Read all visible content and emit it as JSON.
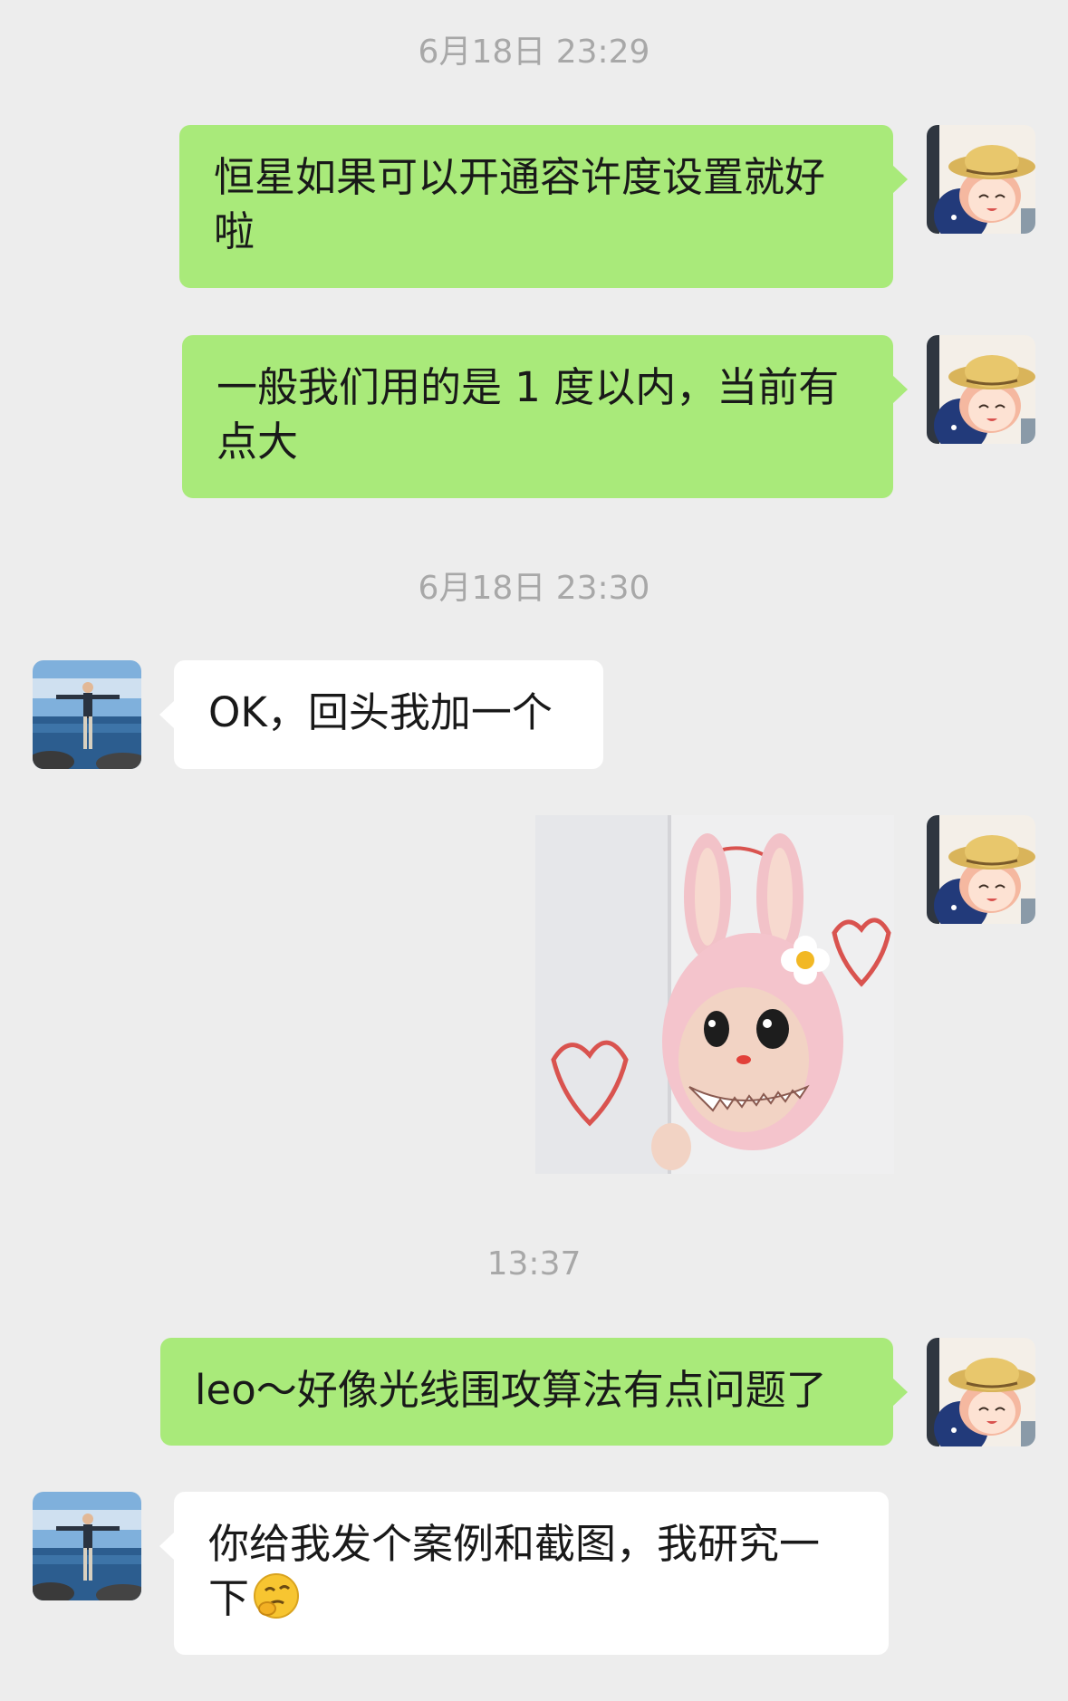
{
  "conversation": {
    "timestamps": [
      "6月18日 23:29",
      "6月18日 23:30",
      "13:37"
    ],
    "messages": [
      {
        "sender": "me",
        "text": "恒星如果可以开通容许度设置就好啦"
      },
      {
        "sender": "me",
        "text": "一般我们用的是 1 度以内，当前有点大"
      },
      {
        "sender": "them",
        "text": "OK，回头我加一个"
      },
      {
        "sender": "me",
        "type": "image",
        "image_icon": "pink-bunny-toy-sticker"
      },
      {
        "sender": "me",
        "text": "leo～好像光线围攻算法有点问题了"
      },
      {
        "sender": "them",
        "text": "你给我发个案例和截图，我研究一下",
        "emoji": "thinking-face-icon"
      }
    ]
  },
  "avatars": {
    "me": "anime-girl-straw-hat-avatar",
    "them": "man-by-sea-avatar"
  },
  "colors": {
    "background": "#ededed",
    "my_bubble": "#a9ea7a",
    "their_bubble": "#ffffff",
    "timestamp_text": "#a8a8a8"
  }
}
